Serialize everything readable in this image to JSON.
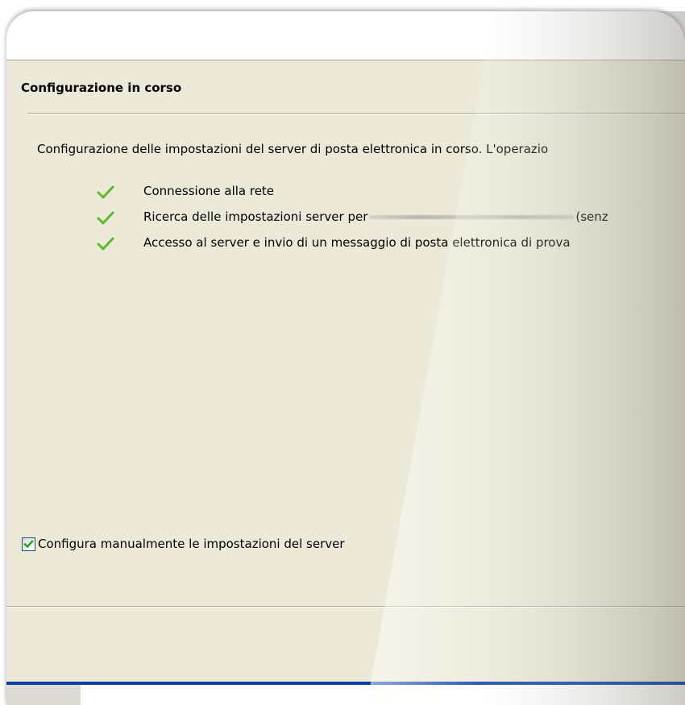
{
  "dialog": {
    "heading": "Configurazione in corso",
    "description": "Configurazione delle impostazioni del server di posta elettronica in corso. L'operazio",
    "steps": [
      {
        "icon": "checkmark-icon",
        "label": "Connessione alla rete",
        "status": "done"
      },
      {
        "icon": "checkmark-icon",
        "label_prefix": "Ricerca delle impostazioni server per",
        "label_suffix": "(senz",
        "status": "done"
      },
      {
        "icon": "checkmark-icon",
        "label": "Accesso al server e invio di un messaggio di posta elettronica di prova",
        "status": "done"
      }
    ],
    "manual_checkbox": {
      "label": "Configura manualmente le impostazioni del server",
      "checked": true
    }
  },
  "colors": {
    "dialog_background": "#ece9d8",
    "check_green": "#5cb82c",
    "taskbar_blue": "#0a3fa8"
  }
}
